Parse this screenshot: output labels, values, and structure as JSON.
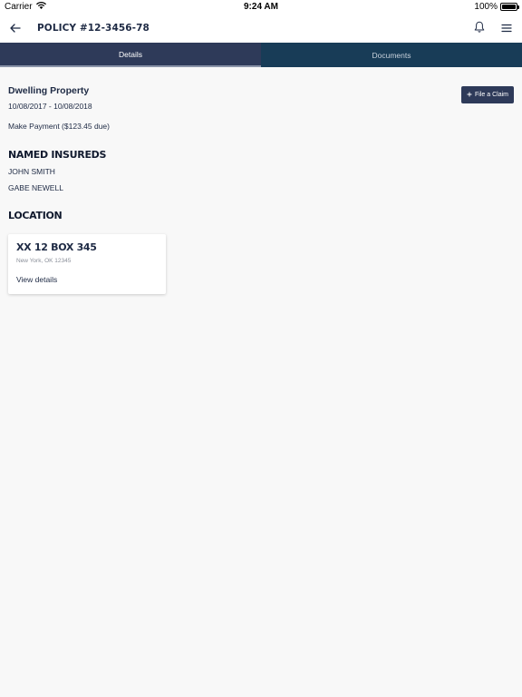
{
  "status_bar": {
    "carrier": "Carrier",
    "time": "9:24 AM",
    "battery": "100%",
    "battery_level": 1.0
  },
  "nav": {
    "title": "POLICY #12-3456-78"
  },
  "tabs": [
    {
      "label": "Details",
      "active": true
    },
    {
      "label": "Documents",
      "active": false
    }
  ],
  "policy": {
    "property_type": "Dwelling Property",
    "date_range": "10/08/2017 - 10/08/2018",
    "payment_link": "Make Payment ($123.45 due)",
    "file_claim_label": "File a Claim"
  },
  "named_insureds": {
    "heading": "NAMED INSUREDS",
    "names": [
      "JOHN SMITH",
      "GABE NEWELL"
    ]
  },
  "location": {
    "heading": "LOCATION",
    "address": "XX 12 BOX 345",
    "city": "New York, OK 12345",
    "link": "View details"
  },
  "colors": {
    "primary": "#2e3a59",
    "tab_inactive": "#183c57",
    "text": "#1e2a44",
    "background": "#f8f8f8"
  },
  "icons": [
    "wifi-icon",
    "battery-icon",
    "back-arrow-icon",
    "bell-icon",
    "hamburger-menu-icon",
    "plus-icon"
  ]
}
